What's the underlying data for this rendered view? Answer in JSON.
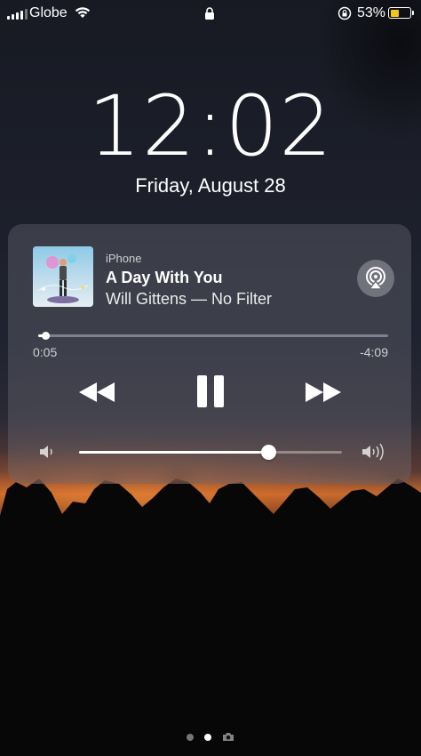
{
  "status_bar": {
    "carrier": "Globe",
    "battery_percent": "53%",
    "battery_level": 0.53,
    "battery_color": "#f5c518"
  },
  "lock_screen": {
    "time": "12:02",
    "date": "Friday, August 28"
  },
  "now_playing": {
    "source": "iPhone",
    "title": "A Day With You",
    "subtitle": "Will Gittens — No Filter",
    "elapsed": "0:05",
    "remaining": "-4:09",
    "progress_fraction": 0.02,
    "volume_fraction": 0.72,
    "icons": [
      "airplay-icon",
      "rewind-icon",
      "pause-icon",
      "fast-forward-icon",
      "volume-low-icon",
      "volume-high-icon"
    ]
  },
  "page_indicator": {
    "pages": 3,
    "active_index": 1,
    "last_page_icon": "camera-icon"
  }
}
